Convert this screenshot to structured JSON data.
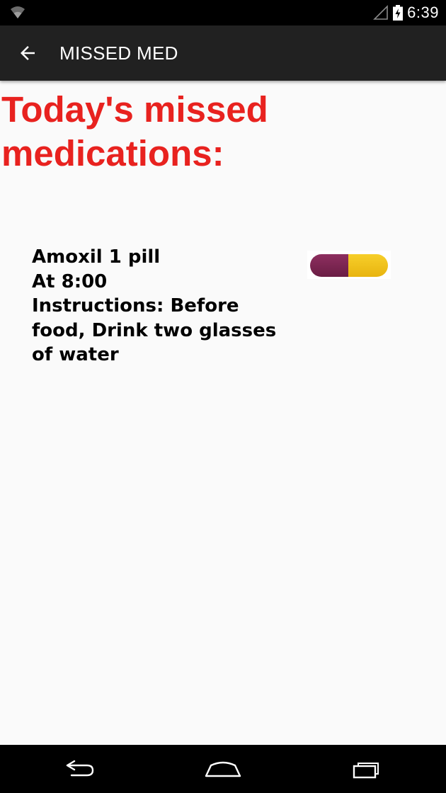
{
  "status_bar": {
    "time": "6:39",
    "icons": [
      "wifi-icon",
      "signal-icon",
      "battery-charging-icon"
    ]
  },
  "app_bar": {
    "title": "MISSED MED",
    "back_icon": "arrow-back-icon"
  },
  "main": {
    "heading": "Today's missed medications:",
    "medications": [
      {
        "name_line": "Amoxil 1 pill",
        "time_line": "At 8:00",
        "instructions_line": "Instructions: Before food, Drink two glasses of water",
        "icon": "capsule-icon",
        "capsule_colors": [
          "#7a2350",
          "#f3c218"
        ]
      }
    ]
  },
  "nav_bar": {
    "icons": [
      "nav-back-icon",
      "nav-home-icon",
      "nav-recents-icon"
    ]
  },
  "colors": {
    "heading": "#e8221f",
    "app_bar": "#212121",
    "status_bar": "#000000",
    "background": "#fafafa"
  }
}
